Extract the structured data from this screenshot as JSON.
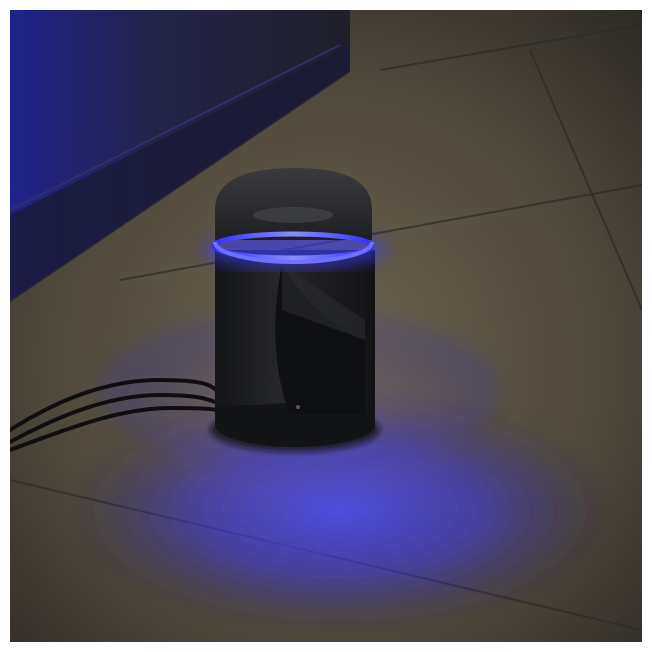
{
  "image": {
    "subject": "bollard-light",
    "scene": "outdoor-paving-at-night",
    "colors": {
      "accent_glow": "#3a3dff",
      "floor": "#4a4439",
      "floor_light": "#6d6350",
      "wall": "#23233f",
      "fixture": "#1c1d20"
    }
  }
}
